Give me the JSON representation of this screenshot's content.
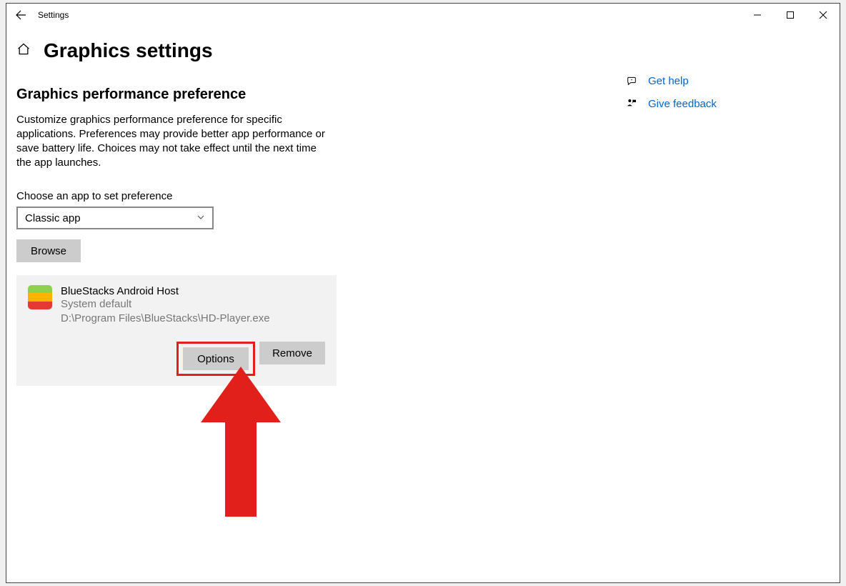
{
  "window": {
    "title": "Settings"
  },
  "page": {
    "title": "Graphics settings",
    "section_title": "Graphics performance preference",
    "description": "Customize graphics performance preference for specific applications. Preferences may provide better app performance or save battery life. Choices may not take effect until the next time the app launches.",
    "choose_label": "Choose an app to set preference",
    "select_value": "Classic app",
    "browse_label": "Browse"
  },
  "app": {
    "name": "BlueStacks Android Host",
    "preference": "System default",
    "path": "D:\\Program Files\\BlueStacks\\HD-Player.exe",
    "options_label": "Options",
    "remove_label": "Remove"
  },
  "help": {
    "get_help": "Get help",
    "feedback": "Give feedback"
  }
}
